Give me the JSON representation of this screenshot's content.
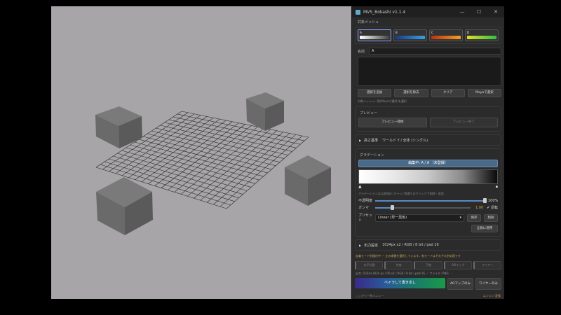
{
  "window": {
    "title": "MVS_Bokashi  v1.1.4",
    "icon": "app-icon",
    "controls": [
      "minimize",
      "maximize",
      "close"
    ]
  },
  "target_mesh": {
    "section_label": "対象メッシュ",
    "swatches": [
      {
        "label": "A",
        "selected": true
      },
      {
        "label": "B",
        "selected": false
      },
      {
        "label": "C",
        "selected": false
      },
      {
        "label": "D",
        "selected": false
      }
    ],
    "name_label": "名前",
    "name_value": "A",
    "buttons": [
      "選択を追加",
      "選択を除去",
      "クリア",
      "Mayaで選択"
    ],
    "hint": "対象メッシュ一覧(Mayaで選択)を選択"
  },
  "preview": {
    "section_label": "プレビュー",
    "start_label": "プレビュー開始",
    "end_label": "プレビュー終了"
  },
  "height_basis": {
    "label": "高さ基準",
    "value": "ワールド Y / 全体 (シングル)"
  },
  "gradation": {
    "section_label": "グラデーション",
    "header": "編集中: A / A （未登録）",
    "hint": "グラデーションは以前保存 (キャップ削除)  右クリックで削除・追加",
    "opacity_label": "不透明度",
    "opacity_value": "100%",
    "opacity": 1.0,
    "gamma_label": "ガンマ",
    "gamma_value": "1.00",
    "gamma": 1.0,
    "invert_label": "反転",
    "preset_label": "プリセット",
    "preset_value": "Linear (単一黒色)",
    "save_label": "保存",
    "delete_label": "削除",
    "apply_all_label": "全員に適用"
  },
  "output_settings": {
    "label": "出力設定",
    "value": "1024px x2 / RGB / 8 bit / pad 16"
  },
  "bake": {
    "status": "定義モード別操作中 — 左の順番を選択しています。各モードはそれぞれ別処理です",
    "modes": [
      "水平分割",
      "共有",
      "下地",
      "AOマップ",
      "ワイヤー"
    ],
    "output_info": "出力: 1024×1024 px / 00 x2 / RGB / 8 bit / pad 16  ／ ファイル: PNG",
    "main_label": "ベイラして書き出し",
    "ao_label": "AOマップのみ",
    "wire_label": "ワイヤーのみ"
  },
  "footer": {
    "left": "ここから一例メニュー",
    "right": "エンジン 変換"
  },
  "colors": {
    "panel_bg": "#2b2b2b",
    "viewport_bg": "#a8a5a8",
    "accent": "#5a8ac0",
    "warning": "#c8a050"
  }
}
